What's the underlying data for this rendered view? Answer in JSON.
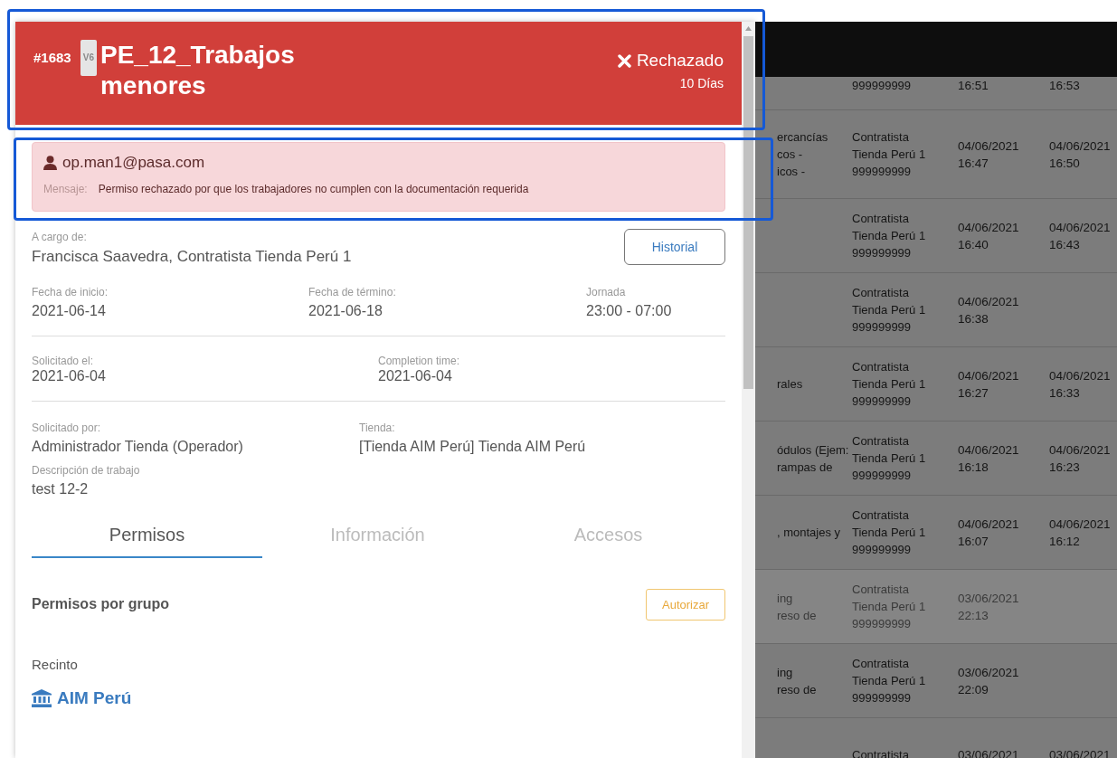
{
  "permit": {
    "number": "#1683",
    "version": "V6",
    "title": "PE_12_Trabajos menores",
    "status": {
      "kind": "rejected",
      "label": "Rechazado"
    },
    "duration": "10 Días"
  },
  "alert": {
    "user": "op.man1@pasa.com",
    "message_label": "Mensaje:",
    "message": "Permiso rechazado por que los trabajadores no cumplen con la documentación requerida"
  },
  "in_charge": {
    "label": "A cargo de:",
    "value": "Francisca Saavedra, Contratista Tienda Perú 1"
  },
  "history_button": "Historial",
  "field_groups": [
    {
      "fields": [
        {
          "label": "Fecha de inicio:",
          "value": "2021-06-14"
        },
        {
          "label": "Fecha de término:",
          "value": "2021-06-18"
        },
        {
          "label": "Jornada",
          "value": "23:00 - 07:00"
        }
      ]
    },
    {
      "fields": [
        {
          "label": "Solicitado el:",
          "value": "2021-06-04"
        },
        {
          "label": "Completion time:",
          "value": "2021-06-04"
        }
      ]
    },
    {
      "fields": [
        {
          "label": "Solicitado por:",
          "value": "Administrador Tienda (Operador)"
        },
        {
          "label": "Tienda:",
          "value": "[Tienda AIM Perú] Tienda AIM Perú"
        }
      ]
    }
  ],
  "description": {
    "label": "Descripción de trabajo",
    "value": "test 12-2"
  },
  "tabs": [
    {
      "label": "Permisos",
      "selected": true
    },
    {
      "label": "Información",
      "selected": false
    },
    {
      "label": "Accesos",
      "selected": false
    }
  ],
  "permissions": {
    "title": "Permisos por grupo",
    "authorize_button": "Autorizar",
    "group_label": "Recinto",
    "group_name": "AIM Perú"
  },
  "background_table": {
    "rows": [
      {
        "column_1": "",
        "column_2": "999999999",
        "column_3": "16:51",
        "column_4": "16:53",
        "dimmed": false
      },
      {
        "column_1": "ercancías\ncos -\nicos -",
        "column_2": "Contratista\nTienda Perú 1\n999999999",
        "column_3": "04/06/2021\n16:47",
        "column_4": "04/06/2021\n16:50",
        "dimmed": false
      },
      {
        "column_1": "",
        "column_2": "Contratista\nTienda Perú 1\n999999999",
        "column_3": "04/06/2021\n16:40",
        "column_4": "04/06/2021\n16:43",
        "dimmed": false
      },
      {
        "column_1": "",
        "column_2": "Contratista\nTienda Perú 1\n999999999",
        "column_3": "04/06/2021\n16:38",
        "column_4": "",
        "dimmed": false
      },
      {
        "column_1": "rales",
        "column_2": "Contratista\nTienda Perú 1\n999999999",
        "column_3": "04/06/2021\n16:27",
        "column_4": "04/06/2021\n16:33",
        "dimmed": false
      },
      {
        "column_1": "ódulos (Ejem:\nrampas de",
        "column_2": "Contratista\nTienda Perú 1\n999999999",
        "column_3": "04/06/2021\n16:18",
        "column_4": "04/06/2021\n16:23",
        "dimmed": false
      },
      {
        "column_1": ", montajes y",
        "column_2": "Contratista\nTienda Perú 1\n999999999",
        "column_3": "04/06/2021\n16:07",
        "column_4": "04/06/2021\n16:12",
        "dimmed": false
      },
      {
        "column_1": "ing\nreso de",
        "column_2": "Contratista\nTienda Perú 1\n999999999",
        "column_3": "03/06/2021\n22:13",
        "column_4": "",
        "dimmed": true
      },
      {
        "column_1": "ing\nreso de",
        "column_2": "Contratista\nTienda Perú 1\n999999999",
        "column_3": "03/06/2021\n22:09",
        "column_4": "",
        "dimmed": false
      },
      {
        "column_1": "",
        "column_2": "Contratista",
        "column_3": "03/06/2021",
        "column_4": "03/06/2021",
        "dimmed": false
      }
    ]
  }
}
